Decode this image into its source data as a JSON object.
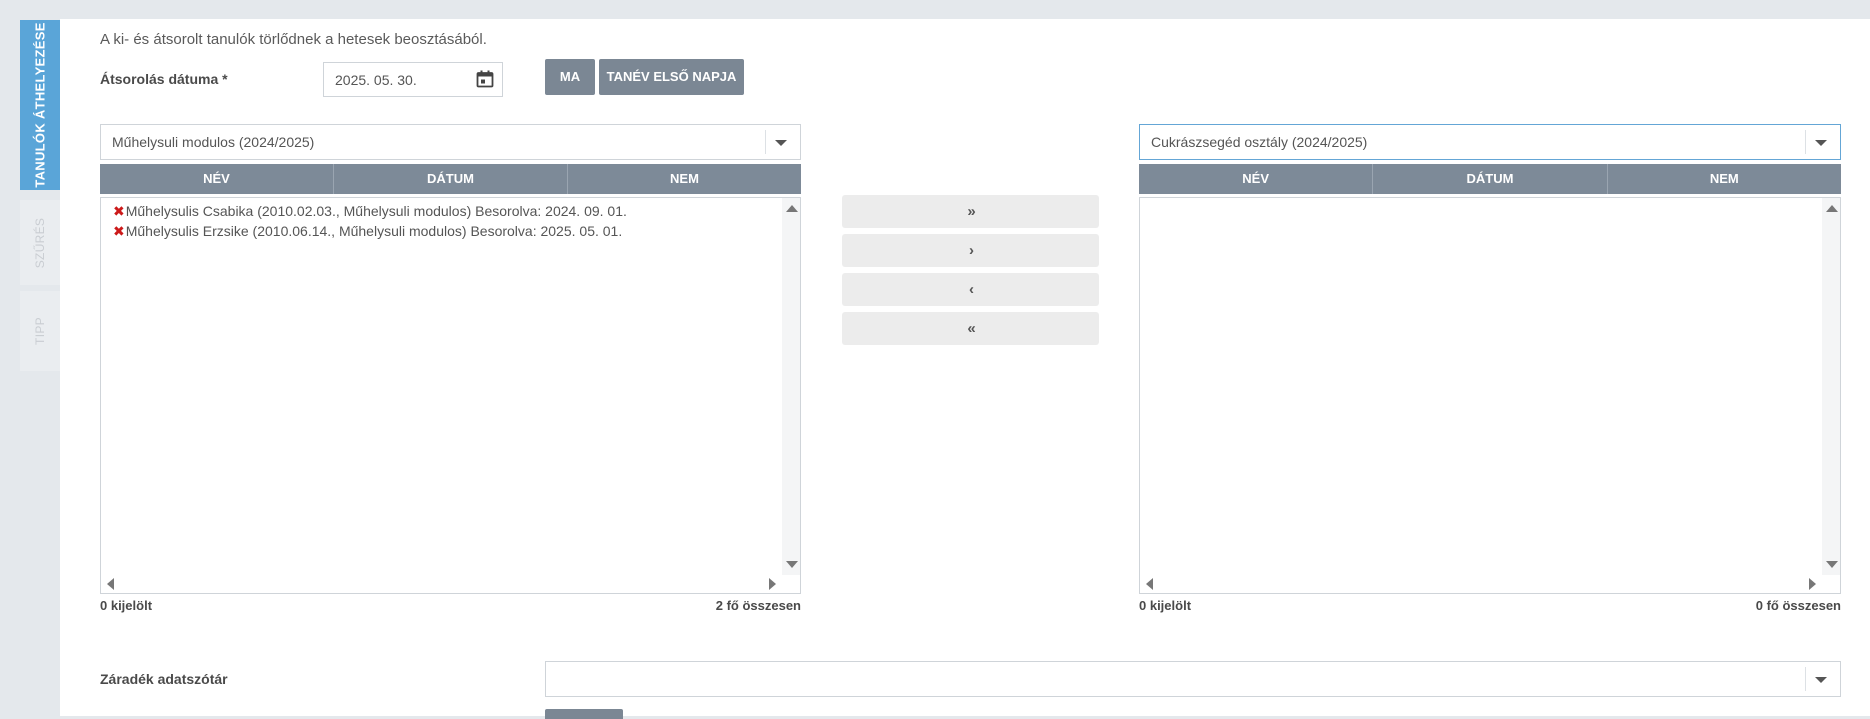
{
  "sidebar": {
    "tabs": [
      {
        "label": "TANULÓK ÁTHELYEZÉSE",
        "active": true
      },
      {
        "label": "SZŰRÉS",
        "active": false
      },
      {
        "label": "TIPP",
        "active": false
      }
    ]
  },
  "info_text": "A ki- és átsorolt tanulók törlődnek a hetesek beosztásából.",
  "date_field": {
    "label": "Átsorolás dátuma *",
    "value": "2025. 05. 30.",
    "icon": "calendar-icon"
  },
  "buttons": {
    "today": "MA",
    "school_year_first_day": "TANÉV ELSŐ NAPJA"
  },
  "left": {
    "select_value": "Műhelysuli modulos (2024/2025)",
    "columns": [
      "NÉV",
      "DÁTUM",
      "NEM"
    ],
    "rows": [
      "Műhelysulis Csabika (2010.02.03., Műhelysuli modulos) Besorolva: 2024. 09. 01.",
      "Műhelysulis Erzsike (2010.06.14., Műhelysuli modulos) Besorolva: 2025. 05. 01."
    ],
    "selected_count": "0 kijelölt",
    "total": "2 fő összesen"
  },
  "right": {
    "select_value": "Cukrászsegéd osztály (2024/2025)",
    "columns": [
      "NÉV",
      "DÁTUM",
      "NEM"
    ],
    "rows": [],
    "selected_count": "0 kijelölt",
    "total": "0 fő összesen"
  },
  "move_buttons": [
    {
      "glyph": "»",
      "icon": "move-all-right-icon"
    },
    {
      "glyph": "›",
      "icon": "move-right-icon"
    },
    {
      "glyph": "‹",
      "icon": "move-left-icon"
    },
    {
      "glyph": "«",
      "icon": "move-all-left-icon"
    }
  ],
  "clause": {
    "label": "Záradék adatszótár",
    "value": ""
  },
  "colors": {
    "accent": "#5aa5d8",
    "header": "#7d8a98",
    "button": "#7b8794",
    "remove": "#cc1a1a"
  }
}
